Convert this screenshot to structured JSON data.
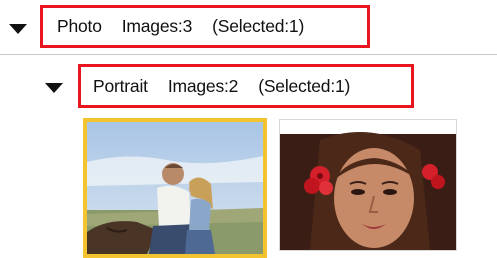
{
  "groups": [
    {
      "name": "Photo",
      "images_label": "Images:3",
      "selected_label": "(Selected:1)",
      "expanded": true,
      "subgroups": [
        {
          "name": "Portrait",
          "images_label": "Images:2",
          "selected_label": "(Selected:1)",
          "expanded": true,
          "thumbnails": [
            {
              "icon": "horse-riding-couple-photo",
              "selected": true
            },
            {
              "icon": "woman-with-red-flowers-photo",
              "selected": false
            }
          ]
        }
      ]
    }
  ],
  "colors": {
    "highlight_border": "#e8141e",
    "selected_thumbnail_border": "#f4c330",
    "divider": "#c9c9c9"
  }
}
